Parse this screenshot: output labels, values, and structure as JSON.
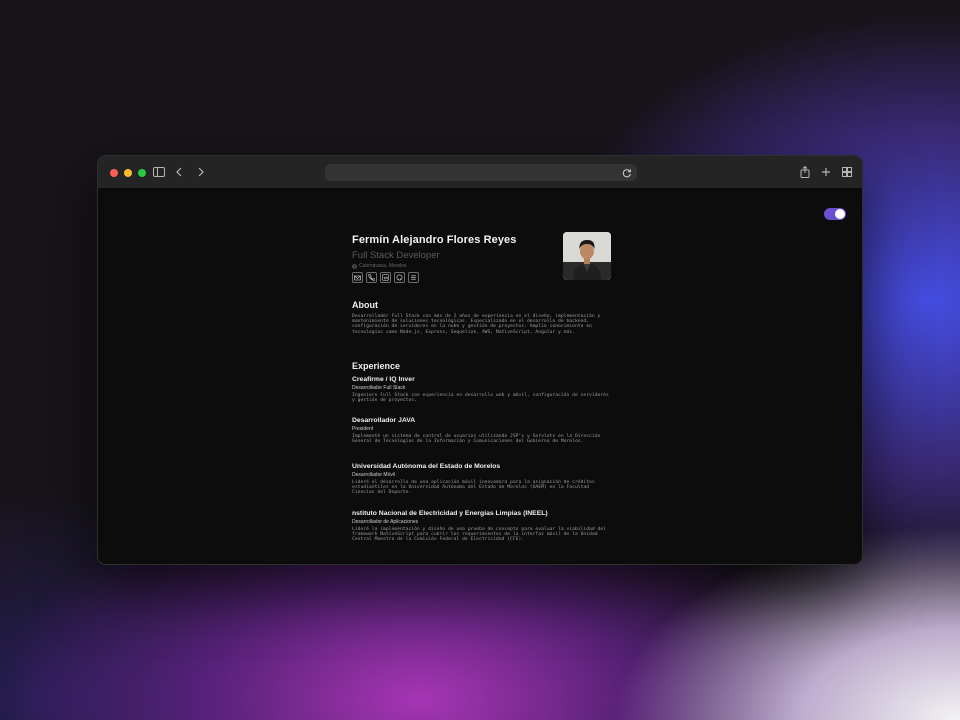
{
  "browser": {
    "traffic_lights": [
      "#ff5f57",
      "#febc2e",
      "#28c840"
    ],
    "icons": [
      "sidebar-icon",
      "back-icon",
      "forward-icon",
      "reload-icon",
      "share-icon",
      "new-tab-icon",
      "tabs-overview-icon"
    ],
    "address": ""
  },
  "theme": {
    "accent": "#6a4fd0",
    "background": "#0c0c0c"
  },
  "profile": {
    "name": "Fermín Alejandro Flores Reyes",
    "role": "Full Stack Developer",
    "location": "Cuernavaca, Morelos",
    "social_icons": [
      "mail-icon",
      "phone-icon",
      "linkedin-icon",
      "github-icon",
      "menu-icon"
    ]
  },
  "about": {
    "title": "About",
    "text": "Desarrollador Full Stack con más de 2 años de experiencia en el diseño, implementación y mantenimiento de soluciones tecnológicas. Especializado en el desarrollo de backend, configuración de servidores en la nube y gestión de proyectos. Amplio conocimiento en tecnologías como Node.js, Express, Sequelize, AWS, NativeScript, Angular y más."
  },
  "experience": {
    "title": "Experience",
    "jobs": [
      {
        "company": "Creafirme / IQ Inver",
        "title": "Desarrollador Full Stack",
        "description": "Ingeniero Full Stack con experiencia en desarrollo web y móvil, configuración de servidores y gestión de proyectos."
      },
      {
        "company": "Desarrollador JAVA",
        "title": "President",
        "description": "Implementé un sistema de control de usuarios utilizando JSP's y Servlets en la Dirección General de Tecnologías de la Información y Comunicaciones del Gobierno de Morelos."
      },
      {
        "company": "Universidad Autónoma del Estado de Morelos",
        "title": "Desarrollador Móvil",
        "description": "Lideré el desarrollo de una aplicación móvil innovadora para la asignación de créditos estudiantiles en la Universidad Autónoma del Estado de Morelos (UAEM) en la Facultad Ciencias del Deporte."
      },
      {
        "company": "nstituto Nacional de Electricidad y Energías Limpias (INEEL)",
        "title": "Desarrollador de Aplicaciones",
        "description": "Lideré la implementación y diseño de una prueba de concepto para evaluar la viabilidad del framework NativeScript para cubrir los requerimientos de la interfaz móvil de la Unidad Central Maestra de la Comisión Federal de Electricidad (CFE)."
      }
    ]
  }
}
